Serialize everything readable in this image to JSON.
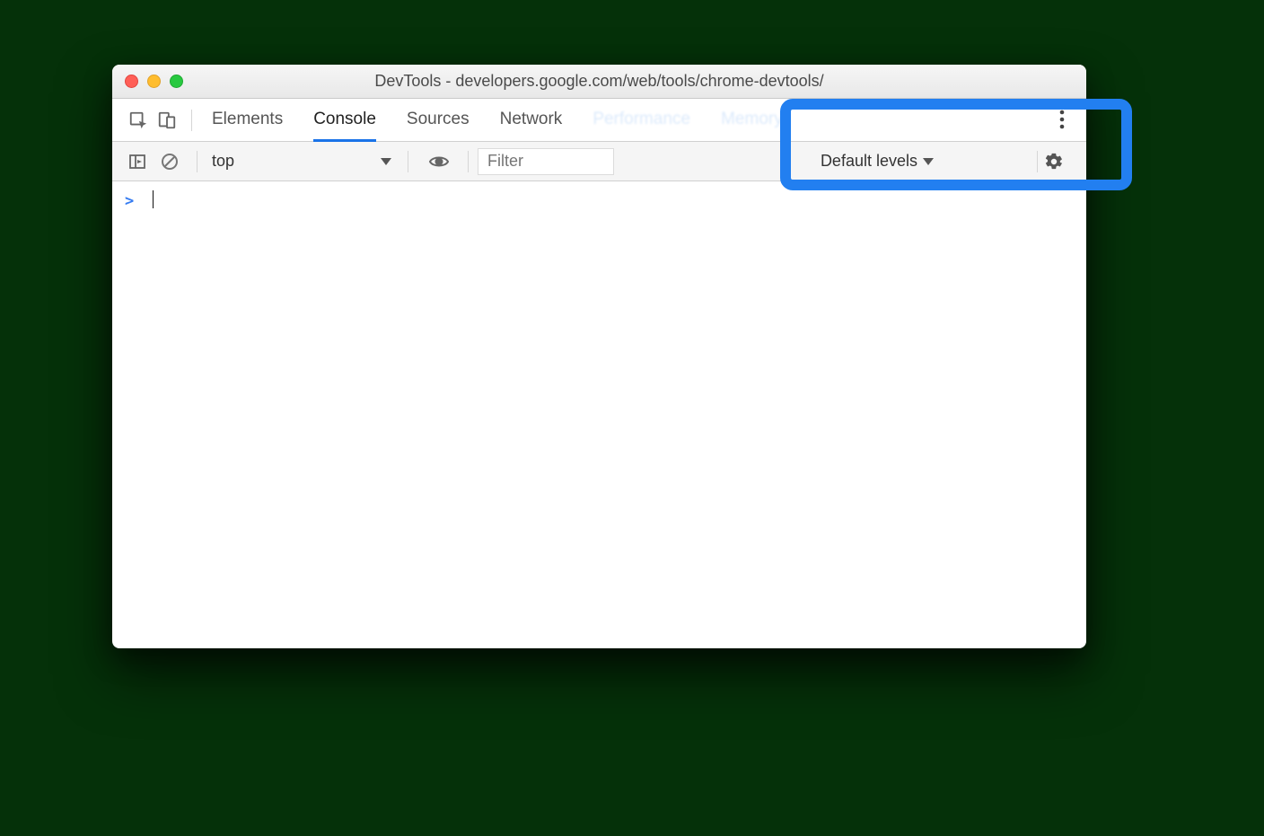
{
  "window": {
    "title": "DevTools - developers.google.com/web/tools/chrome-devtools/"
  },
  "tabs": {
    "elements": "Elements",
    "console": "Console",
    "sources": "Sources",
    "network": "Network",
    "performance": "Performance",
    "memory": "Memory"
  },
  "toolbar": {
    "context": "top",
    "filter_placeholder": "Filter",
    "levels": "Default levels"
  },
  "console": {
    "prompt": ">"
  }
}
